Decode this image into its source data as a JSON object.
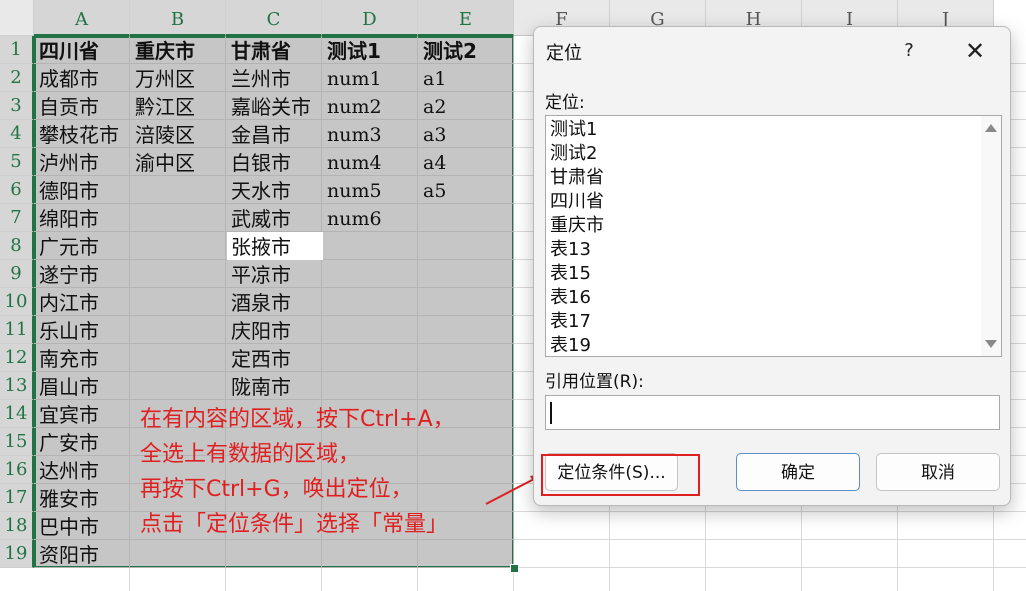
{
  "columns": [
    "A",
    "B",
    "C",
    "D",
    "E",
    "F",
    "G",
    "H",
    "I",
    "J"
  ],
  "rows": [
    "1",
    "2",
    "3",
    "4",
    "5",
    "6",
    "7",
    "8",
    "9",
    "10",
    "11",
    "12",
    "13",
    "14",
    "15",
    "16",
    "17",
    "18",
    "19"
  ],
  "headers": [
    "四川省",
    "重庆市",
    "甘肃省",
    "测试1",
    "测试2"
  ],
  "col_a": [
    "成都市",
    "自贡市",
    "攀枝花市",
    "泸州市",
    "德阳市",
    "绵阳市",
    "广元市",
    "遂宁市",
    "内江市",
    "乐山市",
    "南充市",
    "眉山市",
    "宜宾市",
    "广安市",
    "达州市",
    "雅安市",
    "巴中市",
    "资阳市"
  ],
  "col_b": [
    "万州区",
    "黔江区",
    "涪陵区",
    "渝中区"
  ],
  "col_c": [
    "兰州市",
    "嘉峪关市",
    "金昌市",
    "白银市",
    "天水市",
    "武威市",
    "张掖市",
    "平凉市",
    "酒泉市",
    "庆阳市",
    "定西市",
    "陇南市"
  ],
  "col_d": [
    "num1",
    "num2",
    "num3",
    "num4",
    "num5",
    "num6"
  ],
  "col_e": [
    "a1",
    "a2",
    "a3",
    "a4",
    "a5"
  ],
  "annotation": [
    "在有内容的区域，按下Ctrl+A，",
    "全选上有数据的区域，",
    "再按下Ctrl+G，唤出定位，",
    "点击「定位条件」选择「常量」"
  ],
  "dialog": {
    "title": "定位",
    "help": "?",
    "close": "✕",
    "goto_label": "定位:",
    "list_items": [
      "测试1",
      "测试2",
      "甘肃省",
      "四川省",
      "重庆市",
      "表13",
      "表15",
      "表16",
      "表17",
      "表19"
    ],
    "reference_label": "引用位置(R):",
    "reference_value": "",
    "special_button": "定位条件(S)...",
    "ok_button": "确定",
    "cancel_button": "取消"
  },
  "colors": {
    "selection_border": "#217346",
    "annotation": "#e02020",
    "selection_fill": "#c6c6c6"
  }
}
